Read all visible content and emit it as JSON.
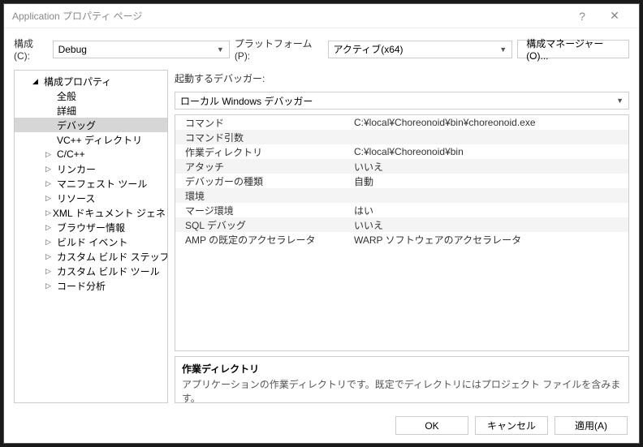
{
  "title": "Application プロパティ ページ",
  "titlebar": {
    "help": "?",
    "close": "✕"
  },
  "toolbar": {
    "config_label": "構成(C):",
    "config_value": "Debug",
    "platform_label": "プラットフォーム(P):",
    "platform_value": "アクティブ(x64)",
    "cfg_mgr": "構成マネージャー(O)..."
  },
  "tree": {
    "root": "構成プロパティ",
    "items": [
      {
        "label": "全般",
        "expandable": false
      },
      {
        "label": "詳細",
        "expandable": false
      },
      {
        "label": "デバッグ",
        "expandable": false,
        "selected": true
      },
      {
        "label": "VC++ ディレクトリ",
        "expandable": false
      },
      {
        "label": "C/C++",
        "expandable": true
      },
      {
        "label": "リンカー",
        "expandable": true
      },
      {
        "label": "マニフェスト ツール",
        "expandable": true
      },
      {
        "label": "リソース",
        "expandable": true
      },
      {
        "label": "XML ドキュメント ジェネレーター",
        "expandable": true
      },
      {
        "label": "ブラウザー情報",
        "expandable": true
      },
      {
        "label": "ビルド イベント",
        "expandable": true
      },
      {
        "label": "カスタム ビルド ステップ",
        "expandable": true
      },
      {
        "label": "カスタム ビルド ツール",
        "expandable": true
      },
      {
        "label": "コード分析",
        "expandable": true
      }
    ]
  },
  "section": {
    "label": "起動するデバッガー:",
    "value": "ローカル Windows デバッガー"
  },
  "props": [
    {
      "key": "コマンド",
      "val": "C:¥local¥Choreonoid¥bin¥choreonoid.exe"
    },
    {
      "key": "コマンド引数",
      "val": ""
    },
    {
      "key": "作業ディレクトリ",
      "val": "C:¥local¥Choreonoid¥bin"
    },
    {
      "key": "アタッチ",
      "val": "いいえ"
    },
    {
      "key": "デバッガーの種類",
      "val": "自動"
    },
    {
      "key": "環境",
      "val": ""
    },
    {
      "key": "マージ環境",
      "val": "はい"
    },
    {
      "key": "SQL デバッグ",
      "val": "いいえ"
    },
    {
      "key": "AMP の既定のアクセラレータ",
      "val": "WARP ソフトウェアのアクセラレータ"
    }
  ],
  "desc": {
    "title": "作業ディレクトリ",
    "text": "アプリケーションの作業ディレクトリです。既定でディレクトリにはプロジェクト ファイルを含みます。"
  },
  "footer": {
    "ok": "OK",
    "cancel": "キャンセル",
    "apply": "適用(A)"
  }
}
